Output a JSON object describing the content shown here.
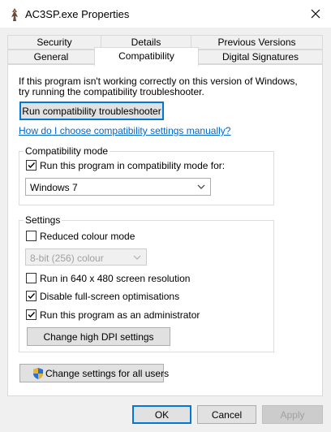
{
  "window": {
    "title": "AC3SP.exe Properties"
  },
  "tabs": {
    "row1": [
      "Security",
      "Details",
      "Previous Versions"
    ],
    "row2": [
      "General",
      "Compatibility",
      "Digital Signatures"
    ],
    "active": "Compatibility"
  },
  "intro": {
    "line1": "If this program isn't working correctly on this version of Windows,",
    "line2": "try running the compatibility troubleshooter."
  },
  "troubleshooter_button": "Run compatibility troubleshooter",
  "help_link": "How do I choose compatibility settings manually?",
  "compat_mode": {
    "legend": "Compatibility mode",
    "checkbox_label": "Run this program in compatibility mode for:",
    "checked": true,
    "selected_os": "Windows 7"
  },
  "settings": {
    "legend": "Settings",
    "reduced_colour_label": "Reduced colour mode",
    "reduced_colour_checked": false,
    "colour_depth": "8-bit (256) colour",
    "low_res_label": "Run in 640 x 480 screen resolution",
    "low_res_checked": false,
    "fullscreen_label": "Disable full-screen optimisations",
    "fullscreen_checked": true,
    "admin_label": "Run this program as an administrator",
    "admin_checked": true,
    "dpi_button": "Change high DPI settings"
  },
  "all_users_button": "Change settings for all users",
  "footer": {
    "ok": "OK",
    "cancel": "Cancel",
    "apply": "Apply"
  },
  "colors": {
    "link": "#0066cc",
    "focus_border": "#0078d7",
    "dialog_bg": "#f0f0f0",
    "panel_bg": "#ffffff"
  }
}
